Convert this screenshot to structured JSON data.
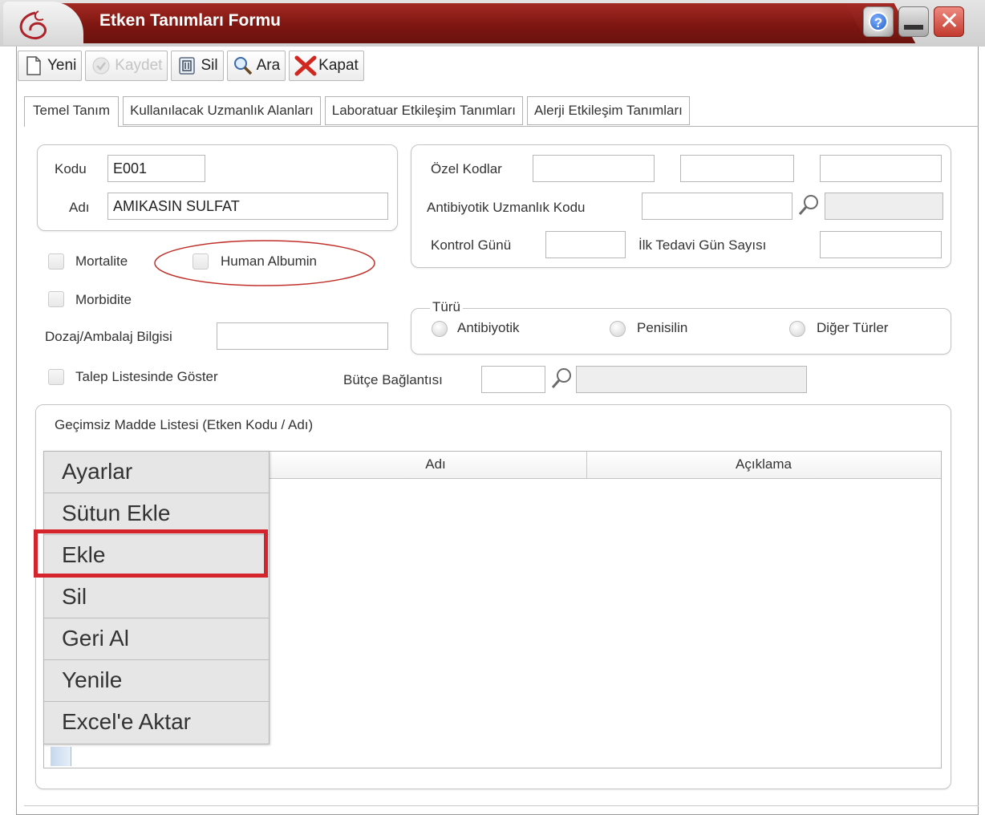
{
  "window": {
    "title": "Etken Tanımları Formu",
    "controls": {
      "help": "?",
      "close": "✕"
    }
  },
  "toolbar": {
    "new_label": "Yeni",
    "save_label": "Kaydet",
    "delete_label": "Sil",
    "search_label": "Ara",
    "close_label": "Kapat"
  },
  "tabs": [
    {
      "label": "Temel Tanım"
    },
    {
      "label": "Kullanılacak Uzmanlık Alanları"
    },
    {
      "label": "Laboratuar Etkileşim Tanımları"
    },
    {
      "label": "Alerji Etkileşim Tanımları"
    }
  ],
  "form": {
    "code_label": "Kodu",
    "code_value": "E001",
    "name_label": "Adı",
    "name_value": "AMIKASIN SULFAT",
    "mortalite_label": "Mortalite",
    "human_albumin_label": "Human Albumin",
    "morbidite_label": "Morbidite",
    "dosage_label": "Dozaj/Ambalaj Bilgisi",
    "dosage_value": "",
    "request_list_label": "Talep Listesinde Göster",
    "budget_label": "Bütçe Bağlantısı",
    "budget_value": "",
    "budget_desc": "",
    "special_codes_label": "Özel Kodlar",
    "special_code_1": "",
    "special_code_2": "",
    "special_code_3": "",
    "antibiotic_code_label": "Antibiyotik Uzmanlık Kodu",
    "antibiotic_code_value": "",
    "antibiotic_code_desc": "",
    "control_day_label": "Kontrol Günü",
    "control_day_value": "",
    "first_treatment_label": "İlk Tedavi Gün Sayısı",
    "first_treatment_value": "",
    "type_legend": "Türü",
    "type_options": [
      "Antibiyotik",
      "Penisilin",
      "Diğer Türler"
    ]
  },
  "incompatible": {
    "title": "Geçimsiz Madde Listesi (Etken Kodu / Adı)",
    "columns": [
      "Adı",
      "Açıklama"
    ]
  },
  "context_menu": {
    "items": [
      "Ayarlar",
      "Sütun Ekle",
      "Ekle",
      "Sil",
      "Geri Al",
      "Yenile",
      "Excel'e Aktar"
    ],
    "highlighted": "Ekle"
  },
  "colors": {
    "title_bar": "#7e1611",
    "highlight": "#d5242b"
  }
}
